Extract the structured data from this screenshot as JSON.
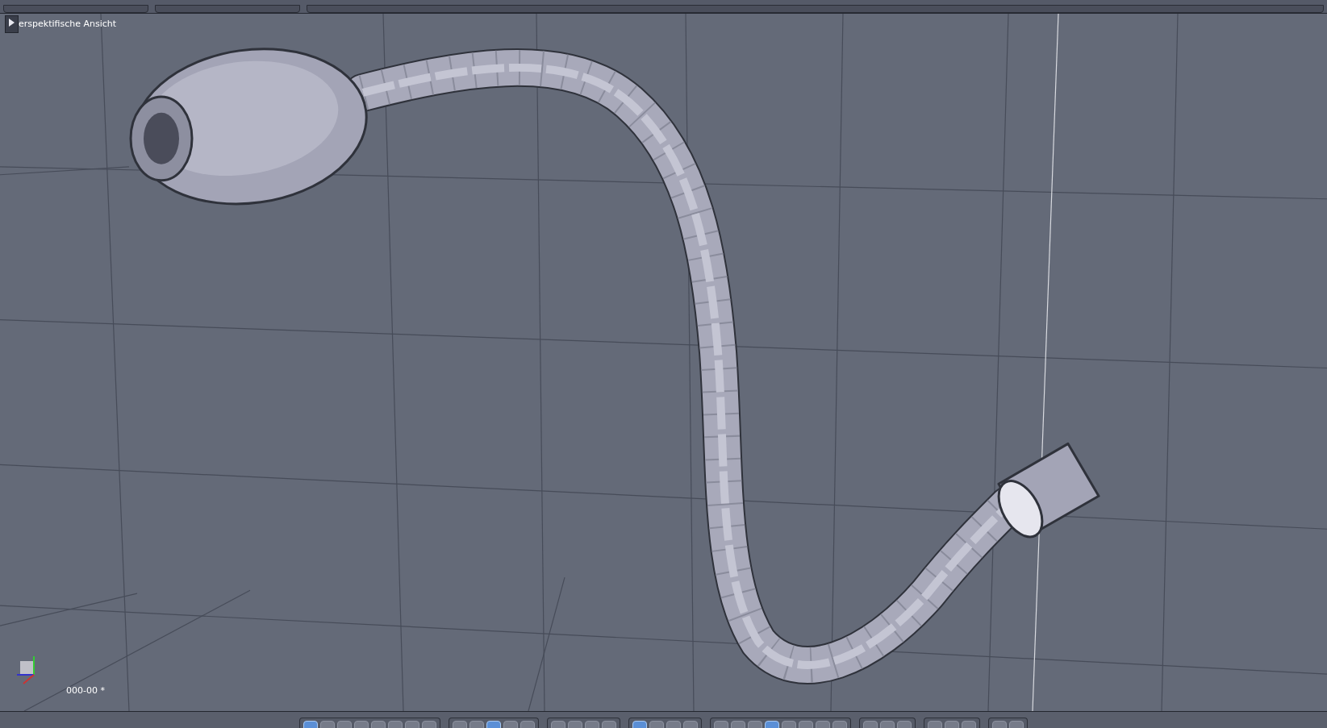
{
  "viewport": {
    "view_label": "erspektifische Ansicht",
    "frame_label": "000-00 *"
  },
  "bottom_toolbar": [
    {
      "buttons": [
        {
          "selected": true
        },
        {
          "selected": false
        },
        {
          "selected": false
        },
        {
          "selected": false
        },
        {
          "selected": false
        },
        {
          "selected": false
        },
        {
          "selected": false
        },
        {
          "selected": false
        }
      ]
    },
    {
      "buttons": [
        {
          "selected": false
        },
        {
          "selected": false
        },
        {
          "selected": true
        },
        {
          "selected": false
        },
        {
          "selected": false
        }
      ]
    },
    {
      "buttons": [
        {
          "selected": false
        },
        {
          "selected": false
        },
        {
          "selected": false
        },
        {
          "selected": false
        }
      ]
    },
    {
      "buttons": [
        {
          "selected": true
        },
        {
          "selected": false
        },
        {
          "selected": false
        },
        {
          "selected": false
        }
      ]
    },
    {
      "buttons": [
        {
          "selected": false
        },
        {
          "selected": false
        },
        {
          "selected": false
        },
        {
          "selected": true
        },
        {
          "selected": false
        },
        {
          "selected": false
        },
        {
          "selected": false
        },
        {
          "selected": false
        }
      ]
    },
    {
      "buttons": [
        {
          "selected": false
        },
        {
          "selected": false
        },
        {
          "selected": false
        }
      ]
    },
    {
      "buttons": [
        {
          "selected": false
        },
        {
          "selected": false
        },
        {
          "selected": false
        }
      ]
    },
    {
      "buttons": [
        {
          "selected": false
        },
        {
          "selected": false
        }
      ]
    }
  ]
}
